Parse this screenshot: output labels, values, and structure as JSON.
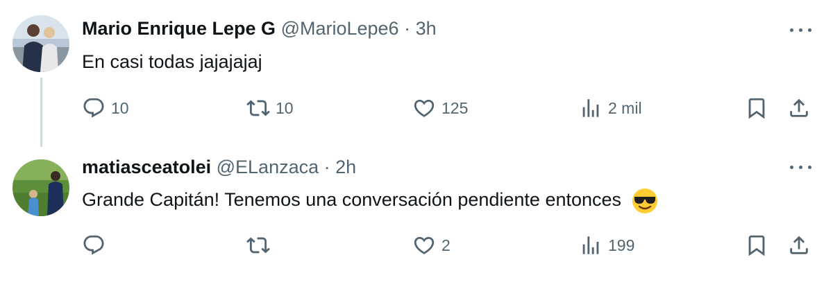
{
  "replies": [
    {
      "name": "Mario Enrique Lepe G",
      "handle": "@MarioLepe6",
      "separator": "·",
      "time": "3h",
      "text": "En casi todas jajajajaj",
      "emoji": "",
      "counts": {
        "replies": "10",
        "reposts": "10",
        "likes": "125",
        "views": "2 mil"
      }
    },
    {
      "name": "matiasceatolei",
      "handle": "@ELanzaca",
      "separator": "·",
      "time": "2h",
      "text": "Grande Capitán! Tenemos una conversación pendiente entonces",
      "emoji": "smiling-face-with-sunglasses",
      "counts": {
        "replies": "",
        "reposts": "",
        "likes": "2",
        "views": "199"
      }
    }
  ],
  "icons": [
    "more-icon",
    "reply-icon",
    "repost-icon",
    "like-icon",
    "views-icon",
    "bookmark-icon",
    "share-icon"
  ],
  "colors": {
    "text": "#0f1419",
    "secondary": "#536471",
    "thread_line": "#cfd9de",
    "background": "#ffffff"
  }
}
